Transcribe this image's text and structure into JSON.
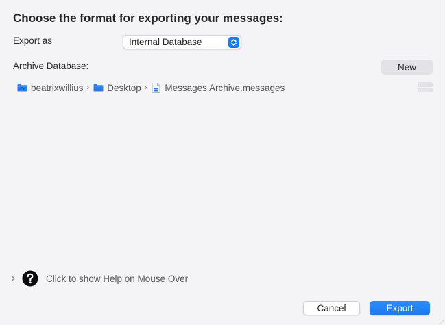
{
  "dialog": {
    "title": "Choose the format for exporting your messages:"
  },
  "export_as": {
    "label": "Export as",
    "selected": "Internal Database"
  },
  "archive": {
    "label": "Archive Database:",
    "new_label": "New",
    "path": [
      {
        "label": "beatrixwillius",
        "icon": "home-folder-icon"
      },
      {
        "label": "Desktop",
        "icon": "folder-icon"
      },
      {
        "label": "Messages Archive.messages",
        "icon": "document-icon"
      }
    ]
  },
  "help": {
    "text": "Click to show Help on Mouse Over"
  },
  "footer": {
    "cancel_label": "Cancel",
    "export_label": "Export"
  },
  "colors": {
    "accent": "#1a7cf7",
    "folder": "#2b7ef0"
  }
}
